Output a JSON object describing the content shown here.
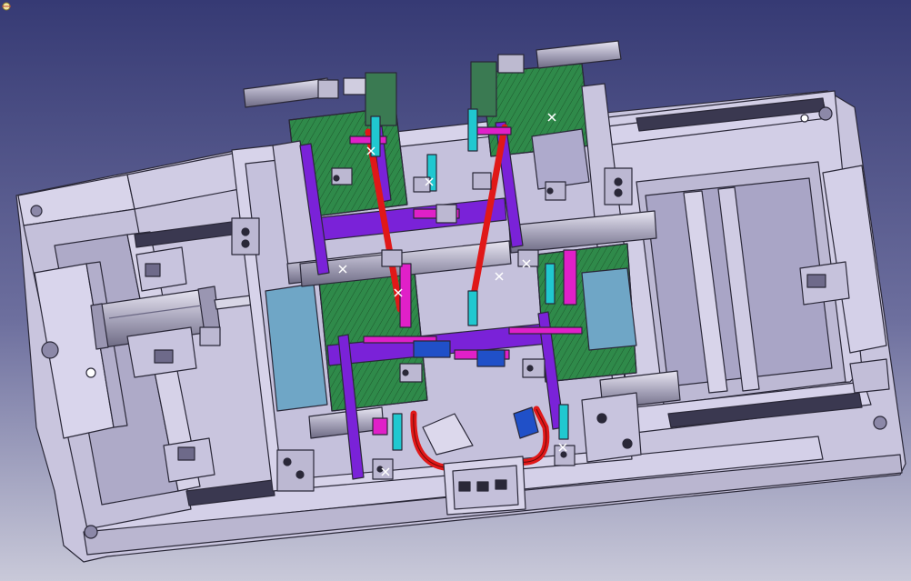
{
  "viewport": {
    "background_top": "#3a3d78",
    "background_bottom": "#c8c8d8",
    "part_fill": "#cfcbe4",
    "part_stroke": "#2a2838"
  },
  "colors": {
    "plate_green": "#2f8a4a",
    "rod_purple": "#7a22d8",
    "link_magenta": "#e020c8",
    "pin_cyan": "#20c8d0",
    "tube_red": "#e01818",
    "slide_blue": "#2050c8",
    "steel_gray": "#b8b8c4"
  },
  "icons": {
    "compass": "compass-icon"
  }
}
